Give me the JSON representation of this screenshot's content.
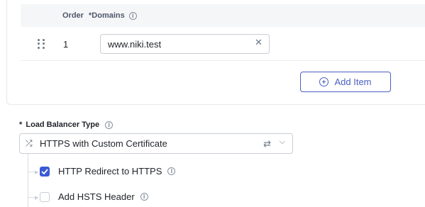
{
  "domains_table": {
    "columns": {
      "order": "Order",
      "domains": "*Domains"
    },
    "rows": [
      {
        "order": "1",
        "domain": "www.niki.test"
      }
    ],
    "add_item_label": "Add Item"
  },
  "load_balancer": {
    "label": "Load Balancer Type",
    "required_mark": "*",
    "selected_value": "HTTPS with Custom Certificate",
    "options": [
      {
        "label": "HTTP Redirect to HTTPS",
        "checked": true
      },
      {
        "label": "Add HSTS Header",
        "checked": false
      }
    ]
  },
  "colors": {
    "accent": "#3b5ad6",
    "button_border": "#4a5fc1"
  }
}
